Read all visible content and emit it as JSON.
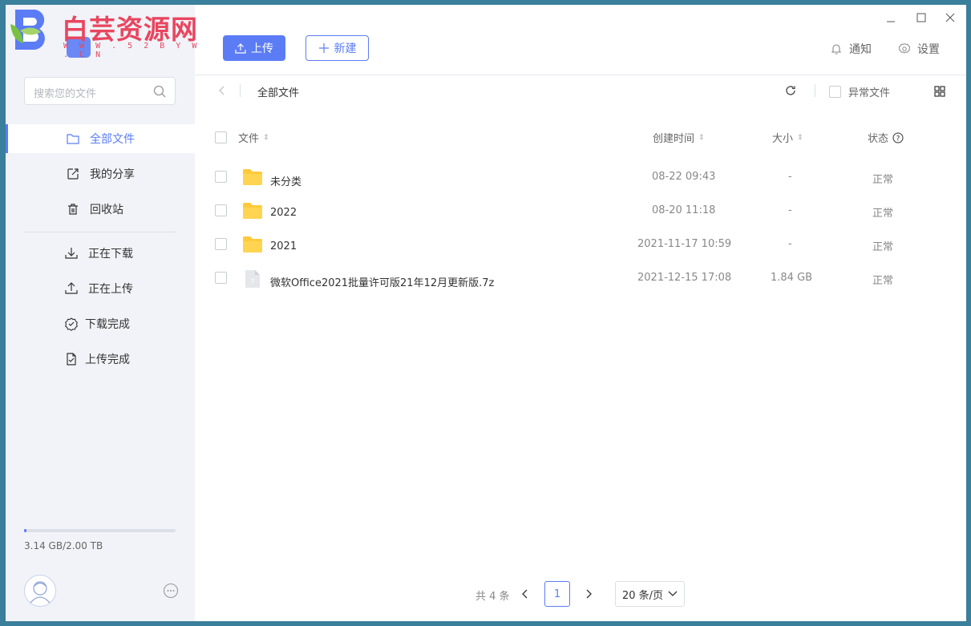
{
  "watermark": {
    "title": "白芸资源网",
    "url": "W W W . 5 2 B Y W . C N"
  },
  "toolbar": {
    "upload_label": "上传",
    "new_label": "新建",
    "notify_label": "通知",
    "settings_label": "设置"
  },
  "sidebar": {
    "search_placeholder": "搜索您的文件",
    "items": [
      {
        "label": "全部文件",
        "icon": "folder-icon"
      },
      {
        "label": "我的分享",
        "icon": "share-icon"
      },
      {
        "label": "回收站",
        "icon": "trash-icon"
      },
      {
        "label": "正在下载",
        "icon": "download-icon"
      },
      {
        "label": "正在上传",
        "icon": "upload-icon"
      },
      {
        "label": "下载完成",
        "icon": "check-circle-icon"
      },
      {
        "label": "上传完成",
        "icon": "check-file-icon"
      }
    ],
    "storage_text": "3.14 GB/2.00 TB",
    "storage_fraction": 0.0016
  },
  "breadcrumb": {
    "current": "全部文件",
    "abnormal_label": "异常文件"
  },
  "table": {
    "headers": {
      "name": "文件",
      "created": "创建时间",
      "size": "大小",
      "status": "状态"
    },
    "rows": [
      {
        "name": "未分类",
        "type": "folder",
        "created": "08-22 09:43",
        "size": "-",
        "status": "正常"
      },
      {
        "name": "2022",
        "type": "folder",
        "created": "08-20 11:18",
        "size": "-",
        "status": "正常"
      },
      {
        "name": "2021",
        "type": "folder",
        "created": "2021-11-17 10:59",
        "size": "-",
        "status": "正常"
      },
      {
        "name": "微软Office2021批量许可版21年12月更新版.7z",
        "type": "file",
        "created": "2021-12-15 17:08",
        "size": "1.84 GB",
        "status": "正常"
      }
    ]
  },
  "pagination": {
    "total": "共 4 条",
    "current_page": "1",
    "page_size": "20 条/页"
  },
  "colors": {
    "accent": "#5b7cf5",
    "folder": "#ffca3a",
    "sidebar_bg": "#f1f3f8"
  }
}
